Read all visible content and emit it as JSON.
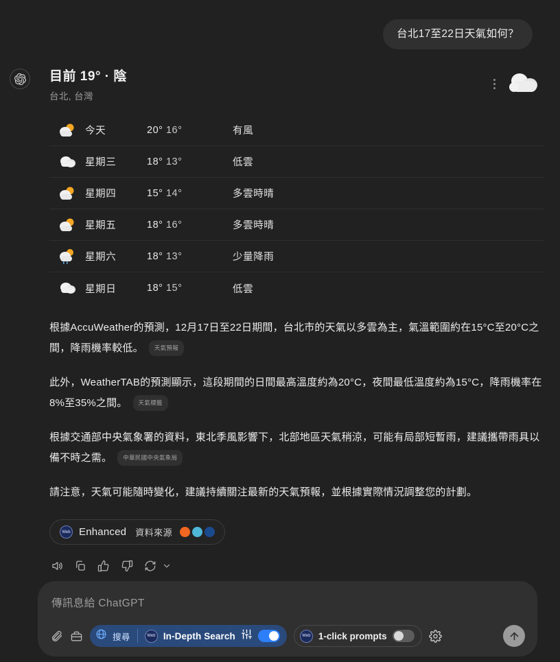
{
  "conversation": {
    "user_message": "台北17至22日天氣如何？",
    "avatar_icon": "openai-logo-icon"
  },
  "weather": {
    "title": "目前 19° · 陰",
    "location": "台北, 台灣",
    "menu_icon": "more-vertical-icon",
    "hero_icon": "cloud-icon",
    "columns": [
      "icon",
      "day",
      "temps",
      "condition"
    ],
    "rows": [
      {
        "icon": "sun-behind-cloud-icon",
        "day": "今天",
        "high": "20°",
        "low": "16°",
        "condition": "有風"
      },
      {
        "icon": "cloud-icon",
        "day": "星期三",
        "high": "18°",
        "low": "13°",
        "condition": "低雲"
      },
      {
        "icon": "sun-behind-cloud-icon",
        "day": "星期四",
        "high": "15°",
        "low": "14°",
        "condition": "多雲時晴"
      },
      {
        "icon": "sun-behind-cloud-icon",
        "day": "星期五",
        "high": "18°",
        "low": "16°",
        "condition": "多雲時晴"
      },
      {
        "icon": "sun-behind-rain-cloud-icon",
        "day": "星期六",
        "high": "18°",
        "low": "13°",
        "condition": "少量降雨"
      },
      {
        "icon": "cloud-icon",
        "day": "星期日",
        "high": "18°",
        "low": "15°",
        "condition": "低雲"
      }
    ]
  },
  "answer": {
    "paragraphs": [
      {
        "text": "根據AccuWeather的預測，12月17日至22日期間，台北市的天氣以多雲為主，氣溫範圍約在15°C至20°C之間，降雨機率較低。",
        "citation": "天氣預報"
      },
      {
        "text": "此外，WeatherTAB的預測顯示，這段期間的日間最高溫度約為20°C，夜間最低溫度約為15°C，降雨機率在8%至35%之間。",
        "citation": "天氣標籤"
      },
      {
        "text": "根據交通部中央氣象署的資料，東北季風影響下，北部地區天氣稍涼，可能有局部短暫雨，建議攜帶雨具以備不時之需。",
        "citation": "中華民國中央氣象局"
      },
      {
        "text": "請注意，天氣可能隨時變化，建議持續關注最新的天氣預報，並根據實際情況調整您的計劃。",
        "citation": ""
      }
    ]
  },
  "enhanced": {
    "badge_icon": "web-badge-icon",
    "label": "Enhanced",
    "sources_label": "資料來源",
    "source_colors": [
      "#f26722",
      "#4fb8d8",
      "#1b4b8f"
    ]
  },
  "actions": [
    {
      "name": "read-aloud-icon",
      "label": "朗讀"
    },
    {
      "name": "copy-icon",
      "label": "複製"
    },
    {
      "name": "thumbs-up-icon",
      "label": "讚"
    },
    {
      "name": "thumbs-down-icon",
      "label": "倒讚"
    },
    {
      "name": "regenerate-icon",
      "label": "重新產生"
    }
  ],
  "composer": {
    "placeholder": "傳訊息給 ChatGPT",
    "attach_icon": "paperclip-icon",
    "toolbox_icon": "toolbox-icon",
    "search_label": "搜尋",
    "search_icon": "globe-icon",
    "indepth_label": "In-Depth Search",
    "sliders_icon": "sliders-icon",
    "indepth_toggle": "on",
    "prompts_label": "1-click prompts",
    "prompts_toggle": "off",
    "settings_icon": "gear-icon",
    "send_icon": "arrow-up-icon"
  },
  "colors": {
    "background": "#212121",
    "bubble": "#303030",
    "accent_blue": "#2d7ff9",
    "pill_blue": "#2a4a7c"
  }
}
